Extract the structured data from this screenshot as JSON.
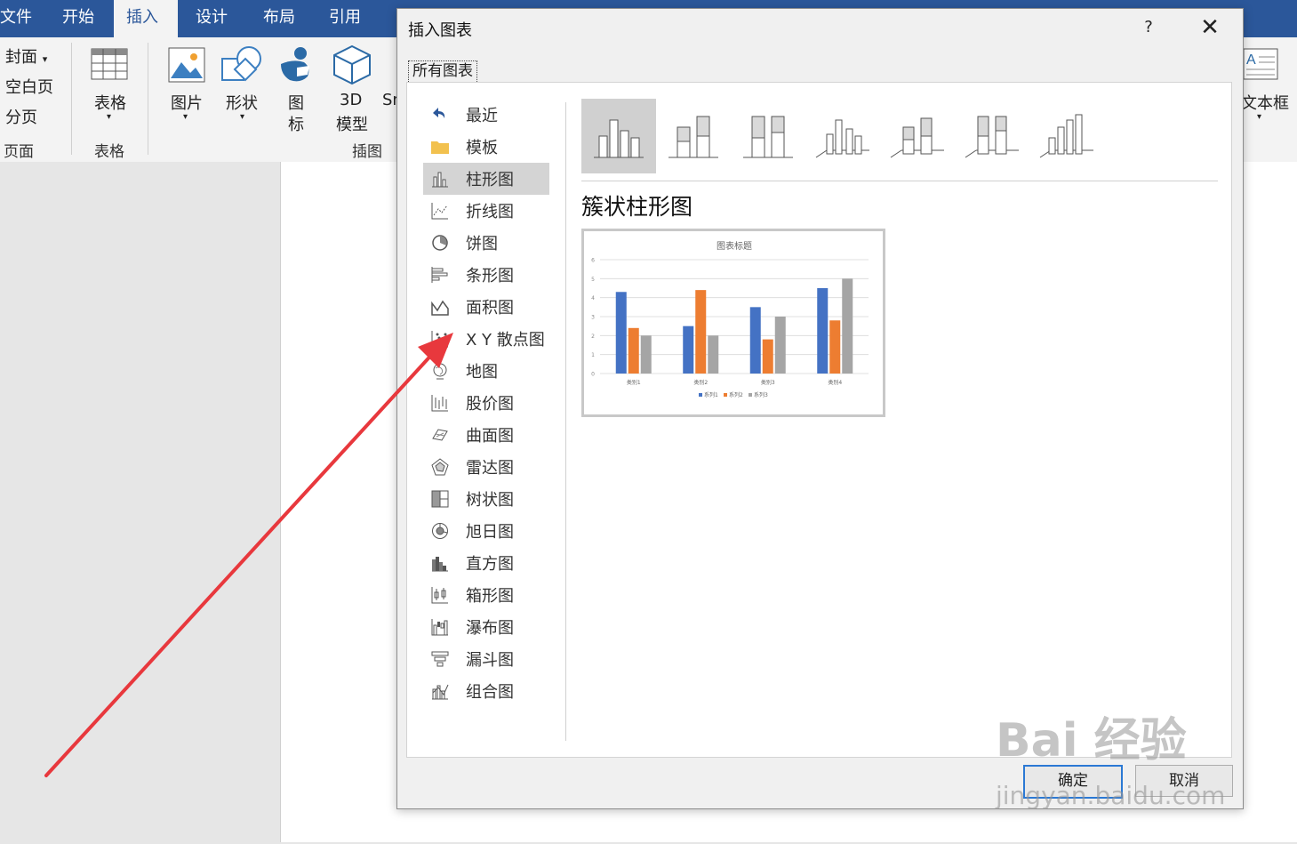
{
  "ribbon": {
    "tabs": [
      "文件",
      "开始",
      "插入",
      "设计",
      "布局",
      "引用"
    ],
    "active_tab": "插入",
    "pages_group": {
      "items": [
        "封面",
        "空白页",
        "分页"
      ],
      "label": "页面"
    },
    "table_group": {
      "button": "表格",
      "label": "表格"
    },
    "illustrations": {
      "picture": "图片",
      "shapes": "形状",
      "icons_l1": "图",
      "icons_l2": "标",
      "model_l1": "3D",
      "model_l2": "模型",
      "smartart": "Sm",
      "label": "插图"
    },
    "textbox": "文本框"
  },
  "dialog": {
    "title": "插入图表",
    "help": "?",
    "close": "✕",
    "tab_all": "所有图表",
    "categories": [
      {
        "label": "最近",
        "icon": "recent-icon"
      },
      {
        "label": "模板",
        "icon": "folder-icon"
      },
      {
        "label": "柱形图",
        "icon": "column-chart-icon"
      },
      {
        "label": "折线图",
        "icon": "line-chart-icon"
      },
      {
        "label": "饼图",
        "icon": "pie-chart-icon"
      },
      {
        "label": "条形图",
        "icon": "bar-chart-icon"
      },
      {
        "label": "面积图",
        "icon": "area-chart-icon"
      },
      {
        "label": "X Y 散点图",
        "icon": "scatter-chart-icon"
      },
      {
        "label": "地图",
        "icon": "map-chart-icon"
      },
      {
        "label": "股价图",
        "icon": "stock-chart-icon"
      },
      {
        "label": "曲面图",
        "icon": "surface-chart-icon"
      },
      {
        "label": "雷达图",
        "icon": "radar-chart-icon"
      },
      {
        "label": "树状图",
        "icon": "treemap-chart-icon"
      },
      {
        "label": "旭日图",
        "icon": "sunburst-chart-icon"
      },
      {
        "label": "直方图",
        "icon": "histogram-chart-icon"
      },
      {
        "label": "箱形图",
        "icon": "box-chart-icon"
      },
      {
        "label": "瀑布图",
        "icon": "waterfall-chart-icon"
      },
      {
        "label": "漏斗图",
        "icon": "funnel-chart-icon"
      },
      {
        "label": "组合图",
        "icon": "combo-chart-icon"
      }
    ],
    "selected_category": "柱形图",
    "subtype_name": "簇状柱形图",
    "ok": "确定",
    "cancel": "取消"
  },
  "chart_data": {
    "type": "bar",
    "title": "图表标题",
    "categories": [
      "类别1",
      "类别2",
      "类别3",
      "类别4"
    ],
    "series": [
      {
        "name": "系列1",
        "values": [
          4.3,
          2.5,
          3.5,
          4.5
        ],
        "color": "#4472c4"
      },
      {
        "name": "系列2",
        "values": [
          2.4,
          4.4,
          1.8,
          2.8
        ],
        "color": "#ed7d31"
      },
      {
        "name": "系列3",
        "values": [
          2,
          2,
          3,
          5
        ],
        "color": "#a5a5a5"
      }
    ],
    "ylim": [
      0,
      6
    ],
    "yticks": [
      "0",
      "1",
      "2",
      "3",
      "4",
      "5",
      "6"
    ],
    "grid": true,
    "legend": "bottom"
  },
  "watermark": {
    "main": "Bai 经验",
    "sub": "jingyan.baidu.com"
  },
  "colors": {
    "ribbon_blue": "#2b579a",
    "annotation_arrow": "#e8383d"
  }
}
